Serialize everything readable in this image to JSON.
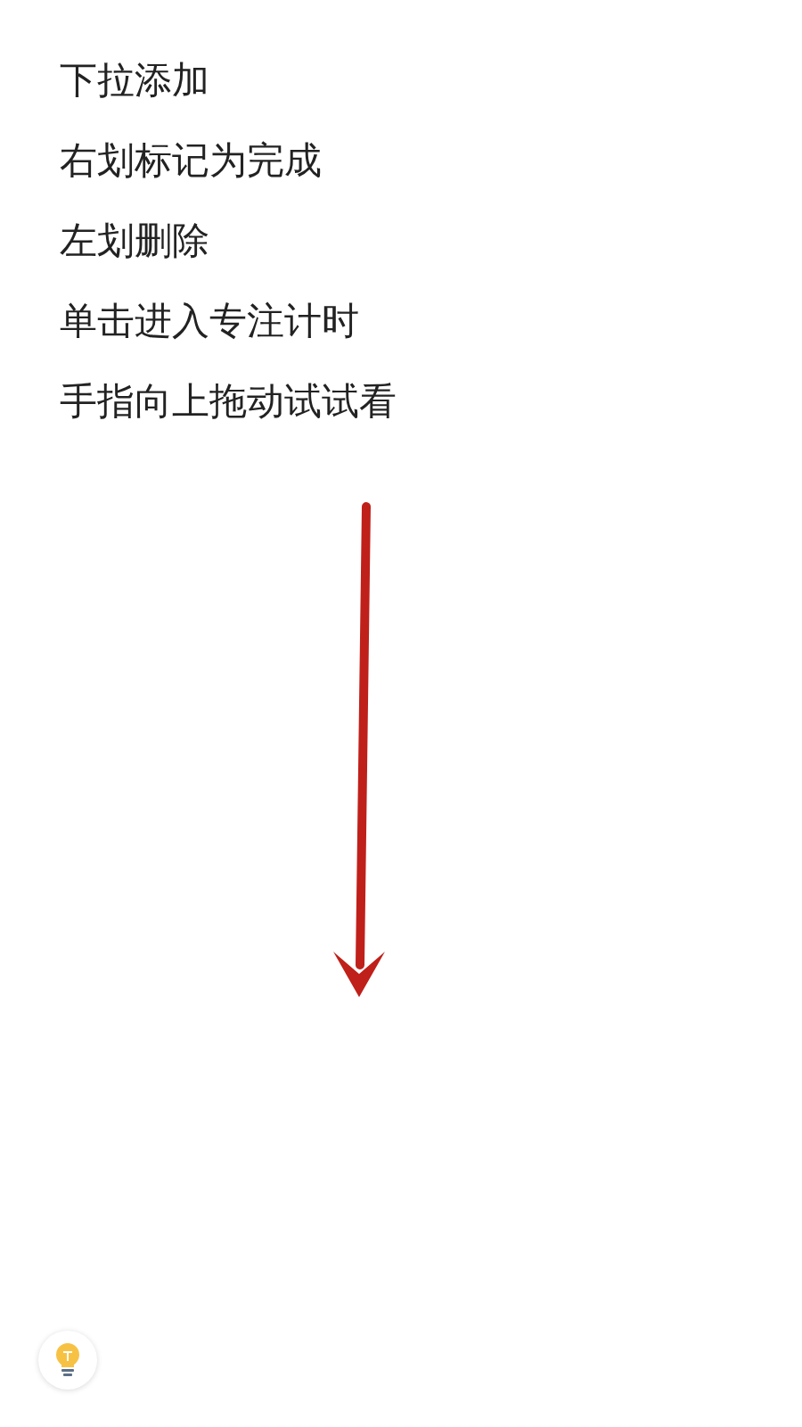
{
  "hints": [
    "下拉添加",
    "右划标记为完成",
    "左划删除",
    "单击进入专注计时",
    "手指向上拖动试试看"
  ],
  "annotation": {
    "kind": "arrow"
  },
  "tip_button": {
    "kind": "bulb"
  }
}
